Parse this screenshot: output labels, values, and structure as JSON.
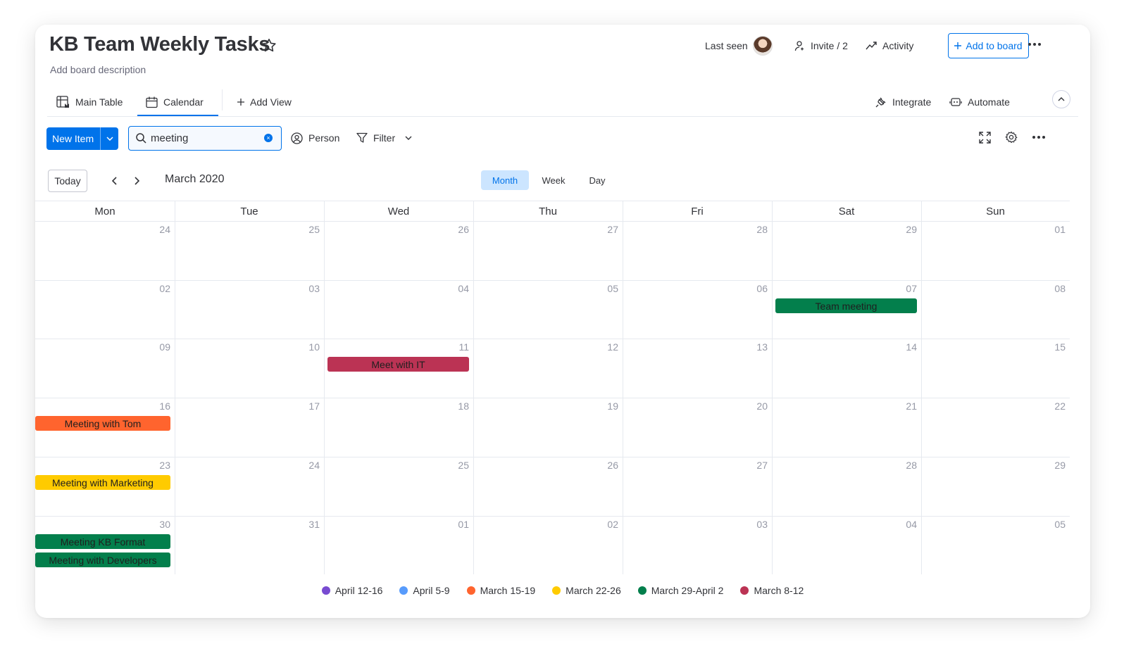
{
  "board": {
    "title": "KB Team Weekly Tasks",
    "description": "Add board description",
    "last_seen_label": "Last seen",
    "invite_label": "Invite / 2",
    "activity_label": "Activity",
    "add_to_board_label": "Add to board"
  },
  "tabs": {
    "main_table": "Main Table",
    "calendar": "Calendar",
    "add_view": "Add View",
    "integrate": "Integrate",
    "automate": "Automate",
    "active": "Calendar"
  },
  "toolbar": {
    "new_item_label": "New Item",
    "search_value": "meeting",
    "person_label": "Person",
    "filter_label": "Filter"
  },
  "calendar": {
    "today_label": "Today",
    "month_title": "March 2020",
    "views": [
      "Month",
      "Week",
      "Day"
    ],
    "active_view": "Month",
    "weekdays": [
      "Mon",
      "Tue",
      "Wed",
      "Thu",
      "Fri",
      "Sat",
      "Sun"
    ],
    "weeks": [
      [
        "24",
        "25",
        "26",
        "27",
        "28",
        "29",
        "01"
      ],
      [
        "02",
        "03",
        "04",
        "05",
        "06",
        "07",
        "08"
      ],
      [
        "09",
        "10",
        "11",
        "12",
        "13",
        "14",
        "15"
      ],
      [
        "16",
        "17",
        "18",
        "19",
        "20",
        "21",
        "22"
      ],
      [
        "23",
        "24",
        "25",
        "26",
        "27",
        "28",
        "29"
      ],
      [
        "30",
        "31",
        "01",
        "02",
        "03",
        "04",
        "05"
      ]
    ],
    "events": [
      {
        "label": "Team meeting",
        "week": 1,
        "day": 5,
        "slot": 0,
        "color": "#037f4c"
      },
      {
        "label": "Meet with IT",
        "week": 2,
        "day": 2,
        "slot": 0,
        "color": "#bb3354"
      },
      {
        "label": "Meeting with Tom",
        "week": 3,
        "day": 0,
        "slot": 0,
        "color": "#ff642e"
      },
      {
        "label": "Meeting with Marketing",
        "week": 4,
        "day": 0,
        "slot": 0,
        "color": "#ffcb00"
      },
      {
        "label": "Meeting KB Format",
        "week": 5,
        "day": 0,
        "slot": 0,
        "color": "#037f4c"
      },
      {
        "label": "Meeting with Developers",
        "week": 5,
        "day": 0,
        "slot": 1,
        "color": "#037f4c"
      }
    ]
  },
  "legend": [
    {
      "label": "April 12-16",
      "color": "#784bd1"
    },
    {
      "label": "April 5-9",
      "color": "#579bfc"
    },
    {
      "label": "March 15-19",
      "color": "#ff642e"
    },
    {
      "label": "March 22-26",
      "color": "#ffcb00"
    },
    {
      "label": "March 29-April 2",
      "color": "#037f4c"
    },
    {
      "label": "March 8-12",
      "color": "#bb3354"
    }
  ],
  "icons": {
    "star": "star-icon",
    "invite": "person-plus-icon",
    "activity": "trend-icon",
    "plus": "plus-icon",
    "more": "more-dots-icon",
    "main_table": "table-icon",
    "calendar": "calendar-icon",
    "integrate": "plug-icon",
    "automate": "robot-icon",
    "search": "search-icon",
    "clear": "clear-icon",
    "person": "person-circle-icon",
    "filter": "funnel-icon",
    "fullscreen": "expand-icon",
    "settings": "gear-icon"
  }
}
